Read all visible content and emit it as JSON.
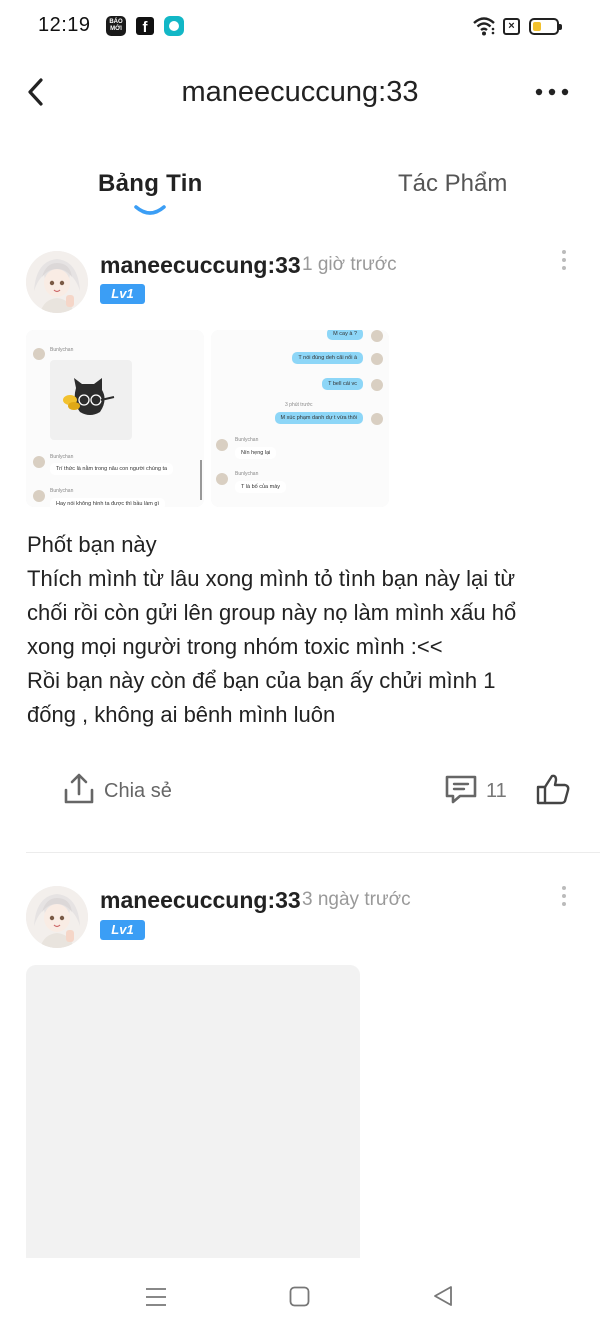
{
  "status_bar": {
    "time": "12:19",
    "apps": [
      "baomoi-icon",
      "facebook-icon",
      "messenger-icon"
    ],
    "baomoi_text": "BÁO MỚI",
    "facebook_glyph": "f",
    "sim_glyph": "×",
    "battery_color": "#f2c12e"
  },
  "header": {
    "title": "maneecuccung:33"
  },
  "tabs": [
    {
      "label": "Bảng Tin",
      "active": true
    },
    {
      "label": "Tác Phẩm",
      "active": false
    }
  ],
  "accent": "#3b9ef5",
  "post1": {
    "author": "maneecuccung:33",
    "time": "1 giờ trước",
    "level": "Lv1",
    "shot1": {
      "sender": "Bunlychan",
      "bubble1": "Trí thức là nằm trong nâu con người chúng ta",
      "bubble2": "Hay nói không hình ta được thì bầu làm gì"
    },
    "shot2": {
      "bubbles_right": [
        "M cay à ?",
        "T nói đúng deh cãi nổi à",
        "T bell cái vc",
        "M xúc phạm danh dự t vừa thôi"
      ],
      "time_sep": "3 phút trước",
      "sender": "Bunlychan",
      "bubbles_left": [
        "Nín hẹng lại",
        "T là bố của mày"
      ]
    },
    "text_lines": [
      "Phốt bạn này",
      "Thích mình từ lâu xong mình tỏ tình bạn này lại từ",
      "chối rồi còn gửi lên group này nọ làm mình xấu hổ",
      "xong mọi người trong nhóm toxic mình :<<",
      "Rồi bạn này còn để bạn của bạn ấy chửi mình 1",
      "đống , không ai bênh mình luôn"
    ],
    "share_label": "Chia sẻ",
    "comment_count": "11"
  },
  "post2": {
    "author": "maneecuccung:33",
    "time": "3 ngày trước",
    "level": "Lv1"
  },
  "navbar": {
    "items": [
      "menu-icon",
      "home-icon",
      "back-icon"
    ]
  }
}
